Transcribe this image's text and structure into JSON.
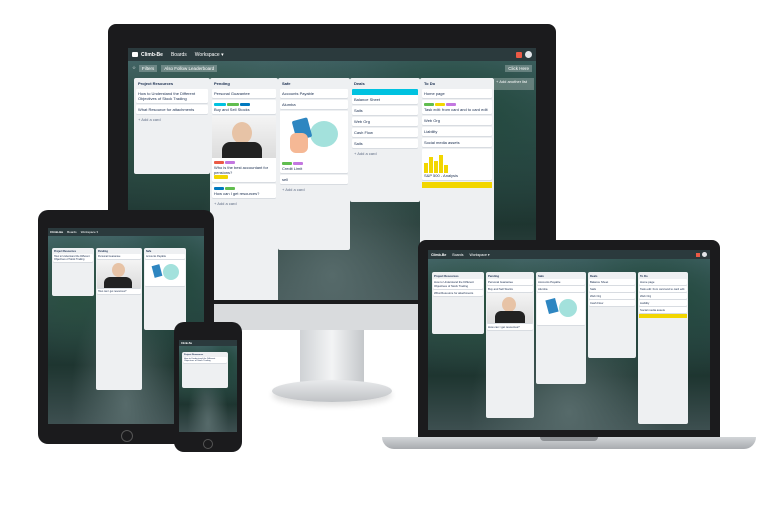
{
  "app": {
    "name": "Climb-Be",
    "nav_boards": "Boards",
    "nav_workspace": "Workspace ▾"
  },
  "board": {
    "filters": "Filters",
    "link_button": "Also Follow Leaderboard",
    "right_btn": "Click Here",
    "add_list": "+ Add another list"
  },
  "lists": [
    {
      "title": "Project Resources",
      "cards": [
        "How to Understand the Different Objectives of Stock Trading",
        "What Resource for attachments"
      ],
      "add": "+ Add a card"
    },
    {
      "title": "Pending",
      "cards": [
        "Personal Guarantee",
        "Buy and Sell Stocks",
        "Who is the best accountant for pensions?",
        "How can I get resources?"
      ],
      "add": "+ Add a card"
    },
    {
      "title": "Safe",
      "cards": [
        "Accounts Payable",
        "Alumba",
        "Credit Limit",
        "sell"
      ],
      "add": "+ Add a card"
    },
    {
      "title": "Deals",
      "cards": [
        "Balance Sheet",
        "Sails",
        "Web Org",
        "Cash Flow",
        "Sails"
      ],
      "add": "+ Add a card"
    },
    {
      "title": "To Do",
      "cards": [
        "Home page",
        "Task edit: from card and to card edit",
        "Web Org",
        "Liability",
        "Social media assets",
        "S&P 500 - Analysis"
      ],
      "add": "+ Add a card"
    }
  ],
  "colors": {
    "nav": "#2b3a3d",
    "green": "#61bd4f",
    "yellow": "#f2d600",
    "orange": "#ff9f1a",
    "purple": "#c377e0",
    "blue": "#0079bf",
    "teal": "#00c2e0",
    "red": "#eb5a46"
  },
  "icons": {
    "logo": "board-logo-icon",
    "user": "user-avatar-icon",
    "notify": "notification-icon"
  }
}
